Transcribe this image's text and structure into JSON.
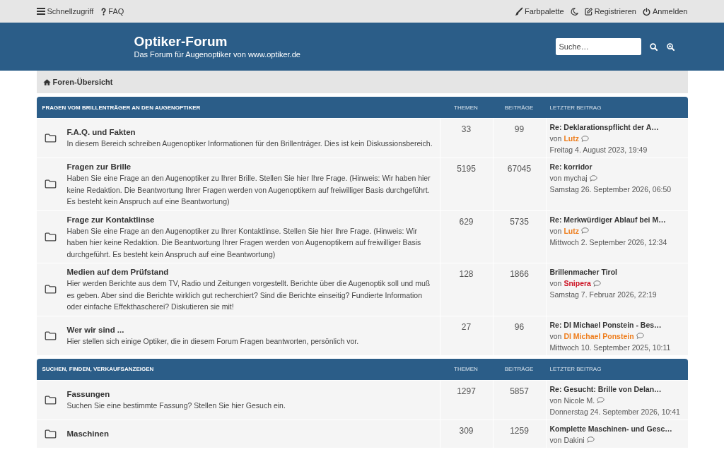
{
  "top_bar": {
    "quick_access": "Schnellzugriff",
    "faq": "FAQ",
    "color_palette": "Farbpalette",
    "register": "Registrieren",
    "login": "Anmelden"
  },
  "header": {
    "title": "Optiker-Forum",
    "subtitle": "Das Forum für Augenoptiker von www.optiker.de",
    "search": {
      "placeholder": "Suche…"
    }
  },
  "breadcrumb": {
    "label": "Foren-Übersicht"
  },
  "sections": [
    {
      "title": "FRAGEN VOM BRILLENTRÄGER AN DEN AUGENOPTIKER",
      "columns": [
        "THEMEN",
        "BEITRÄGE",
        "LETZTER BEITRAG"
      ],
      "forums": [
        {
          "title": "F.A.Q. und Fakten",
          "description": "In diesem Bereich schreiben Augenoptiker Informationen für den Brillenträger. Dies ist kein Diskussionsbereich.",
          "topics": "33",
          "posts": "99",
          "last_post": {
            "title": "Re: Deklarationspflicht der A…",
            "by": "von",
            "author": {
              "name": "Lutz",
              "kind": "group",
              "color": "#ee7d1c"
            },
            "date": "Freitag 4. August 2023, 19:49"
          }
        },
        {
          "title": "Fragen zur Brille",
          "description": "Haben Sie eine Frage an den Augenoptiker zu Ihrer Brille. Stellen Sie hier Ihre Frage. (Hinweis: Wir haben hier keine Redaktion. Die Beantwortung Ihrer Fragen werden von Augenoptikern auf freiwilliger Basis durchgeführt. Es besteht kein Anspruch auf eine Beantwortung)",
          "topics": "5195",
          "posts": "67045",
          "last_post": {
            "title": "Re: korridor",
            "by": "von",
            "author": {
              "name": "mychaj",
              "kind": "member",
              "color": "#555555"
            },
            "date": "Samstag 26. September 2026, 06:50"
          }
        },
        {
          "title": "Frage zur Kontaktlinse",
          "description": "Haben Sie eine Frage an den Augenoptiker zu Ihrer Kontaktlinse. Stellen Sie hier Ihre Frage. (Hinweis: Wir haben hier keine Redaktion. Die Beantwortung Ihrer Fragen werden von Augenoptikern auf freiwilliger Basis durchgeführt. Es besteht kein Anspruch auf eine Beantwortung)",
          "topics": "629",
          "posts": "5735",
          "last_post": {
            "title": "Re: Merkwürdiger Ablauf bei M…",
            "by": "von",
            "author": {
              "name": "Lutz",
              "kind": "group",
              "color": "#ee7d1c"
            },
            "date": "Mittwoch 2. September 2026, 12:34"
          }
        },
        {
          "title": "Medien auf dem Prüfstand",
          "description": "Hier werden Berichte aus dem TV, Radio und Zeitungen vorgestellt. Berichte über die Augenoptik soll und muß es geben. Aber sind die Berichte wirklich gut recherchiert? Sind die Berichte einseitig? Fundierte Information oder einfache Effekthascherei? Diskutieren sie mit!",
          "topics": "128",
          "posts": "1866",
          "last_post": {
            "title": "Brillenmacher Tirol",
            "by": "von",
            "author": {
              "name": "Snipera",
              "kind": "group",
              "color": "#cc1122"
            },
            "date": "Samstag 7. Februar 2026, 22:19"
          }
        },
        {
          "title": "Wer wir sind ...",
          "description": "Hier stellen sich einige Optiker, die in diesem Forum Fragen beantworten, persönlich vor.",
          "topics": "27",
          "posts": "96",
          "last_post": {
            "title": "Re: DI Michael Ponstein - Bes…",
            "by": "von",
            "author": {
              "name": "DI Michael Ponstein",
              "kind": "group",
              "color": "#ee7d1c"
            },
            "date": "Mittwoch 10. September 2025, 10:11"
          }
        }
      ]
    },
    {
      "title": "SUCHEN, FINDEN, VERKAUFSANZEIGEN",
      "columns": [
        "THEMEN",
        "BEITRÄGE",
        "LETZTER BEITRAG"
      ],
      "forums": [
        {
          "title": "Fassungen",
          "description": "Suchen Sie eine bestimmte Fassung? Stellen Sie hier Gesuch ein.",
          "topics": "1297",
          "posts": "5857",
          "last_post": {
            "title": "Re: Gesucht: Brille von Delan…",
            "by": "von",
            "author": {
              "name": "Nicole M.",
              "kind": "member",
              "color": "#555555"
            },
            "date": "Donnerstag 24. September 2026, 10:41"
          }
        },
        {
          "title": "Maschinen",
          "topics": "309",
          "posts": "1259",
          "last_post": {
            "title": "Komplette Maschinen- und Gesc…",
            "by": "von",
            "author": {
              "name": "Dakini",
              "kind": "member",
              "color": "#555555"
            }
          }
        }
      ]
    }
  ]
}
